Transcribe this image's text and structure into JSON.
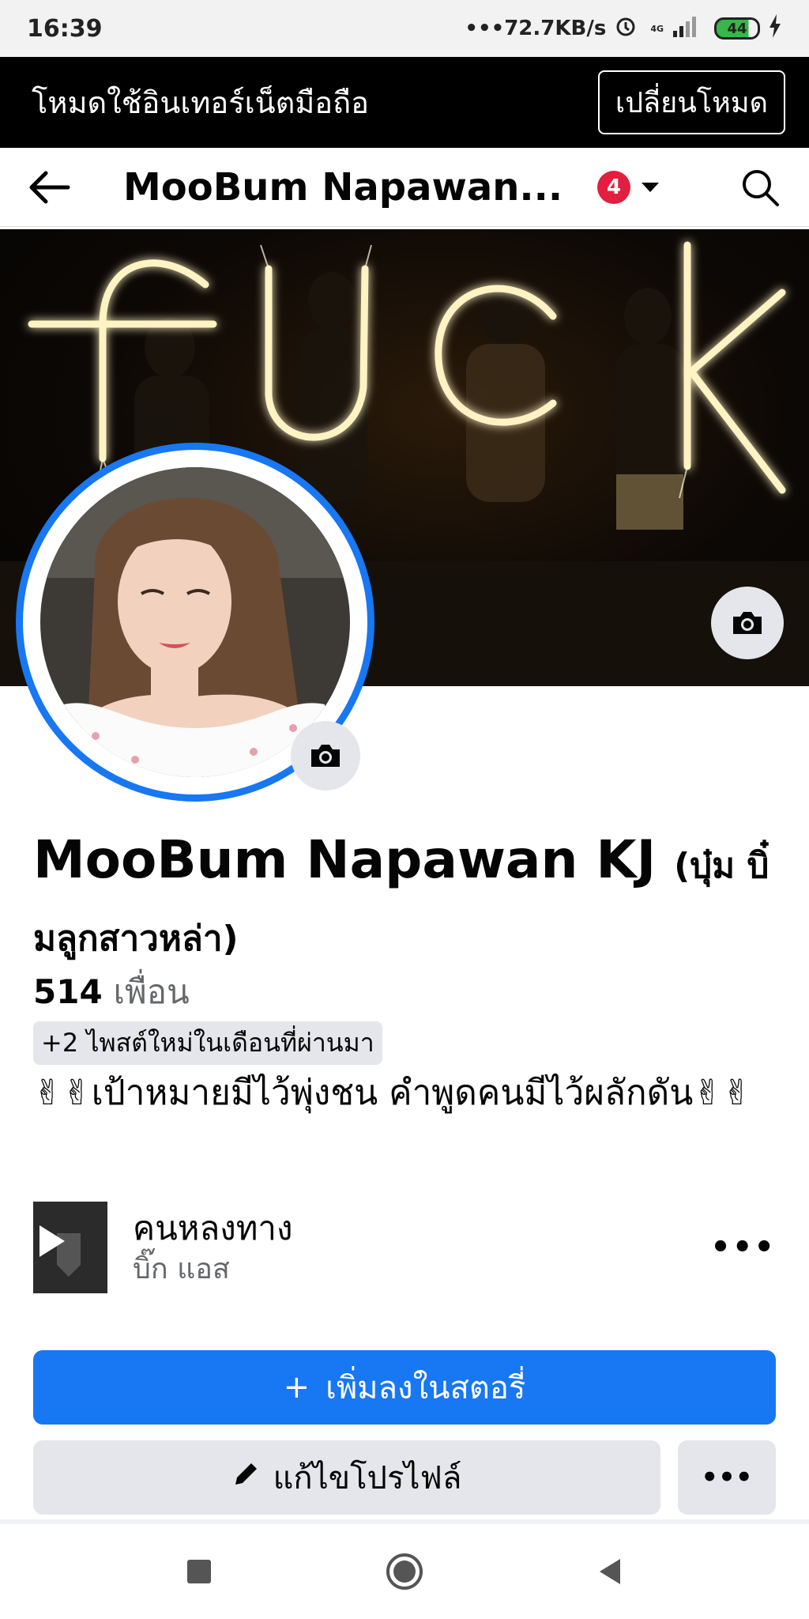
{
  "status_bar": {
    "time": "16:39",
    "network_speed": "•••72.7KB/s",
    "network_type": "4G",
    "battery": "44",
    "icons": [
      "alarm-icon",
      "signal-icon",
      "battery-icon",
      "charging-icon"
    ]
  },
  "mode_banner": {
    "text": "โหมดใช้อินเทอร์เน็ตมือถือ",
    "button": "เปลี่ยนโหมด"
  },
  "nav": {
    "title": "MooBum Napawan...",
    "notification_count": "4",
    "icons": [
      "back-arrow-icon",
      "chevron-down-icon",
      "search-icon"
    ]
  },
  "cover": {
    "icons": [
      "camera-icon"
    ]
  },
  "profile": {
    "name": "MooBum Napawan KJ",
    "nickname": "(บุ๋ม บิ๋มลูกสาวหล่า)",
    "friends_count": "514",
    "friends_label": "เพื่อน",
    "new_posts": "+2 ไพสต์ใหม่ในเดือนที่ผ่านมา",
    "bio": "✌✌เป้าหมายมีไว้พุ่งชน คำพูดคนมีไว้ผลักดัน✌✌"
  },
  "music": {
    "title": "คนหลงทาง",
    "artist": "บิ๊ก แอส",
    "more": "•••"
  },
  "actions": {
    "add_story": "เพิ่มลงในสตอรี่",
    "add_story_icon": "+",
    "edit_profile": "แก้ไขโปรไฟล์",
    "more": "•••"
  },
  "colors": {
    "primary_blue": "#1877f2",
    "badge_red": "#e41e3f",
    "button_gray": "#e4e6eb",
    "secondary_text": "#65676b"
  }
}
